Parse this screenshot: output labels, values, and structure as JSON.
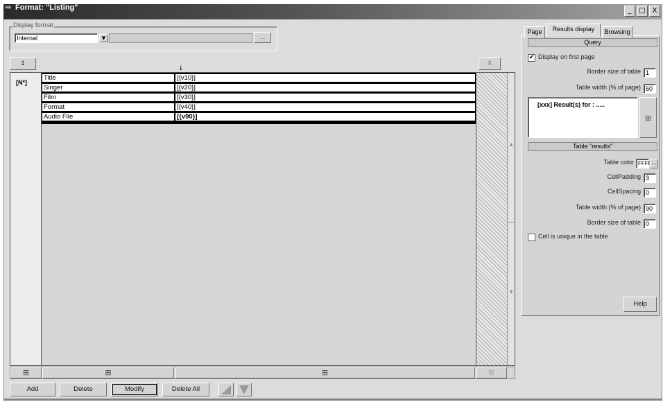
{
  "window": {
    "title": "Format: \"Listing\"",
    "icon": "app-format-icon"
  },
  "title_controls": {
    "minimize": "_",
    "maximize": "□",
    "close": "X"
  },
  "display_format": {
    "group_label": "Display format",
    "select_value": "Internal",
    "browse_label": "..."
  },
  "editor": {
    "col_tab_label": "1",
    "close_label": "X",
    "row_label": "[N*]",
    "cursor_marker": "↓",
    "rows": [
      {
        "label": "Title",
        "value": "[{v10}]"
      },
      {
        "label": "Singer",
        "value": "[{v20}]"
      },
      {
        "label": "Film",
        "value": "[{v30}]"
      },
      {
        "label": "Format",
        "value": "[{v40}]"
      },
      {
        "label": "Audio File",
        "value": "[{v90}]"
      }
    ],
    "scroll_up": "▲",
    "scroll_down": "▼"
  },
  "bottom_buttons": {
    "add": "Add",
    "delete": "Delete",
    "modify": "Modify",
    "delete_all": "Delete All"
  },
  "tabs": {
    "page": "Page",
    "results_display": "Results display",
    "browsing": "Browsing"
  },
  "query": {
    "header": "Query",
    "display_first_page_label": "Display on first page",
    "display_first_page_checked": "✔",
    "border_size_label": "Border size of table",
    "border_size_value": "1",
    "table_width_label": "Table width (% of page)",
    "table_width_value": "60",
    "result_text": "[xxx] Result(s) for : ....."
  },
  "table_results": {
    "header": "Table \"results\"",
    "table_color_label": "Table color",
    "table_color_value": "FFFFFF",
    "color_browse": "...",
    "cellpadding_label": "CellPadding",
    "cellpadding_value": "3",
    "cellspacing_label": "CellSpacing",
    "cellspacing_value": "0",
    "table_width_label": "Table width (% of page)",
    "table_width_value": "90",
    "border_size_label": "Border size of table",
    "border_size_value": "0",
    "cell_unique_label": "Cell is unique in the table"
  },
  "help_label": "Help",
  "icons": {
    "grid_icon": "⊞"
  }
}
